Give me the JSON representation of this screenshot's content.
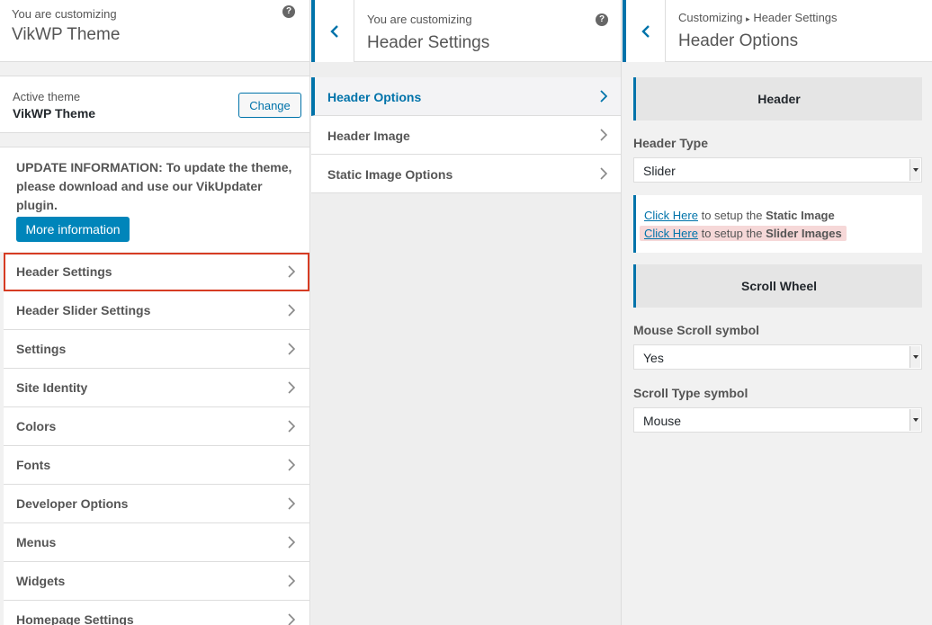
{
  "panel1": {
    "header": {
      "small": "You are customizing",
      "big": "VikWP Theme"
    },
    "active_theme": {
      "label": "Active theme",
      "name": "VikWP Theme",
      "change_label": "Change"
    },
    "update": {
      "text": "UPDATE INFORMATION: To update the theme, please download and use our VikUpdater plugin.",
      "button_label": "More information"
    },
    "menu": [
      {
        "label": "Header Settings",
        "highlighted": true
      },
      {
        "label": "Header Slider Settings"
      },
      {
        "label": "Settings"
      },
      {
        "label": "Site Identity"
      },
      {
        "label": "Colors"
      },
      {
        "label": "Fonts"
      },
      {
        "label": "Developer Options"
      },
      {
        "label": "Menus"
      },
      {
        "label": "Widgets"
      },
      {
        "label": "Homepage Settings"
      }
    ]
  },
  "panel2": {
    "header": {
      "small": "You are customizing",
      "big": "Header Settings"
    },
    "items": [
      {
        "label": "Header Options",
        "active": true
      },
      {
        "label": "Header Image"
      },
      {
        "label": "Static Image Options"
      }
    ]
  },
  "panel3": {
    "header": {
      "breadcrumb_root": "Customizing",
      "breadcrumb_sep": "▸",
      "breadcrumb_current": "Header Settings",
      "big": "Header Options"
    },
    "header_section": "Header",
    "header_type": {
      "label": "Header Type",
      "value": "Slider"
    },
    "info": {
      "line1": {
        "link": "Click Here",
        "text": " to setup the ",
        "bold": "Static Image"
      },
      "line2": {
        "link": "Click Here",
        "text": " to setup the ",
        "bold": "Slider Images"
      }
    },
    "scroll_section": "Scroll Wheel",
    "mouse_scroll": {
      "label": "Mouse Scroll symbol",
      "value": "Yes"
    },
    "scroll_type": {
      "label": "Scroll Type symbol",
      "value": "Mouse"
    }
  },
  "colors": {
    "accent": "#0073aa",
    "button": "#0085ba",
    "highlight_border": "#d63c23",
    "highlight_bg": "#f6d8d8"
  },
  "icons": {
    "help": "question-circle-icon",
    "back": "chevron-left-icon",
    "forward": "chevron-right-icon"
  }
}
